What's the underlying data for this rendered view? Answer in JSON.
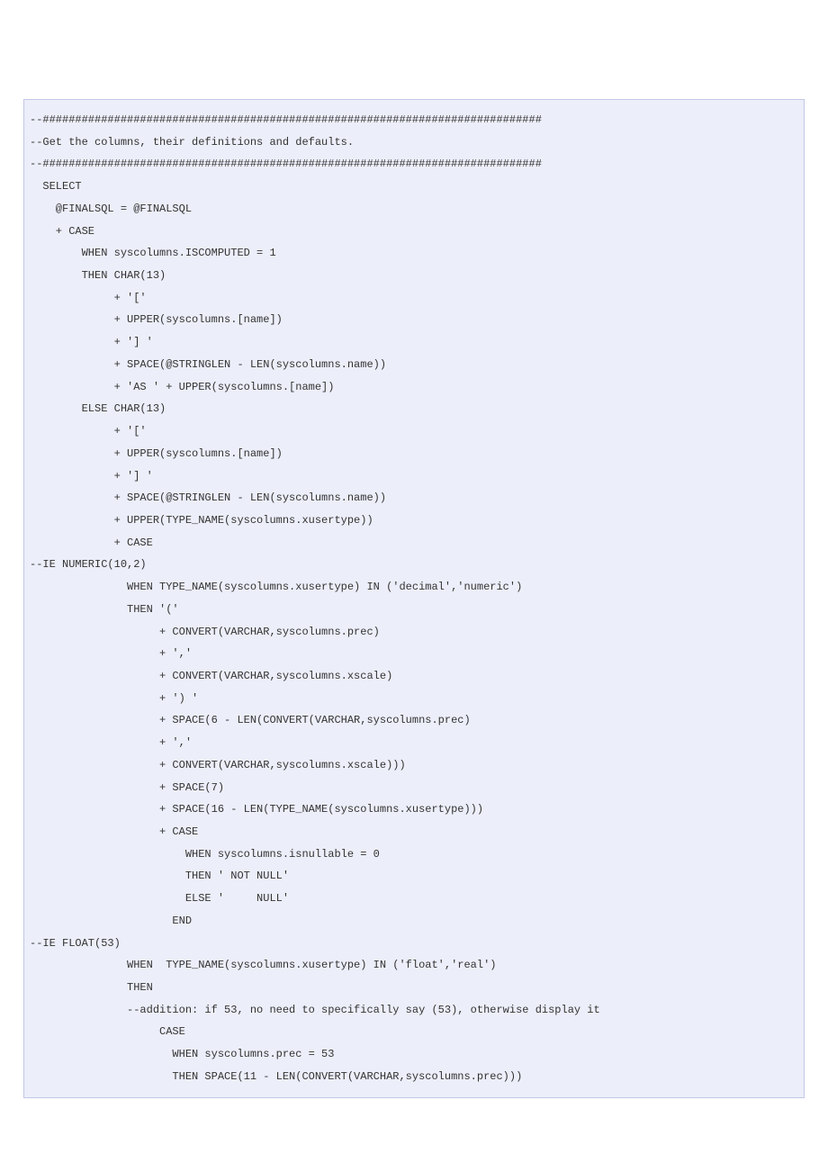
{
  "code": {
    "lines": [
      "--#############################################################################",
      "--Get the columns, their definitions and defaults.",
      "--#############################################################################",
      "  SELECT",
      "    @FINALSQL = @FINALSQL",
      "    + CASE",
      "        WHEN syscolumns.ISCOMPUTED = 1",
      "        THEN CHAR(13)",
      "             + '['",
      "             + UPPER(syscolumns.[name])",
      "             + '] '",
      "             + SPACE(@STRINGLEN - LEN(syscolumns.name))",
      "             + 'AS ' + UPPER(syscolumns.[name])",
      "        ELSE CHAR(13)",
      "             + '['",
      "             + UPPER(syscolumns.[name])",
      "             + '] '",
      "             + SPACE(@STRINGLEN - LEN(syscolumns.name))",
      "             + UPPER(TYPE_NAME(syscolumns.xusertype))",
      "             + CASE",
      "--IE NUMERIC(10,2)",
      "               WHEN TYPE_NAME(syscolumns.xusertype) IN ('decimal','numeric')",
      "               THEN '('",
      "                    + CONVERT(VARCHAR,syscolumns.prec)",
      "                    + ','",
      "                    + CONVERT(VARCHAR,syscolumns.xscale)",
      "                    + ') '",
      "                    + SPACE(6 - LEN(CONVERT(VARCHAR,syscolumns.prec)",
      "                    + ','",
      "                    + CONVERT(VARCHAR,syscolumns.xscale)))",
      "                    + SPACE(7)",
      "                    + SPACE(16 - LEN(TYPE_NAME(syscolumns.xusertype)))",
      "                    + CASE",
      "                        WHEN syscolumns.isnullable = 0",
      "                        THEN ' NOT NULL'",
      "                        ELSE '     NULL'",
      "                      END",
      "--IE FLOAT(53)",
      "               WHEN  TYPE_NAME(syscolumns.xusertype) IN ('float','real')",
      "               THEN",
      "               --addition: if 53, no need to specifically say (53), otherwise display it",
      "                    CASE",
      "                      WHEN syscolumns.prec = 53",
      "                      THEN SPACE(11 - LEN(CONVERT(VARCHAR,syscolumns.prec)))"
    ]
  }
}
